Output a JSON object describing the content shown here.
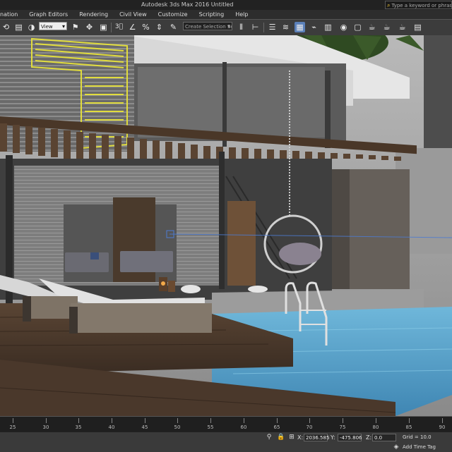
{
  "window": {
    "title": "Autodesk 3ds Max 2016    Untitled",
    "search_placeholder": "Type a keyword or phrase"
  },
  "menu": {
    "items": [
      "nation",
      "Graph Editors",
      "Rendering",
      "Civil View",
      "Customize",
      "Scripting",
      "Help"
    ]
  },
  "toolbar": {
    "view_dropdown": "View",
    "selection_set": "Create Selection Se",
    "icons": [
      "undo-icon",
      "select-link-icon",
      "bind-spacewarp-icon",
      "view-dropdown",
      "select-filter-icon",
      "move-icon",
      "scale-icon",
      "snap-3-icon",
      "angle-snap-icon",
      "percent-snap-icon",
      "spinner-snap-icon",
      "edit-named-selection-icon",
      "mirror-icon",
      "align-icon",
      "layer-manager-icon",
      "ribbon-icon",
      "curve-editor-icon",
      "schematic-view-icon",
      "material-editor-icon",
      "render-setup-icon",
      "rendered-frame-icon",
      "render-icon",
      "render-iterative-icon",
      "activeshade-icon"
    ]
  },
  "timeline": {
    "ticks": [
      "25",
      "30",
      "35",
      "40",
      "45",
      "50",
      "55",
      "60",
      "65",
      "70",
      "75",
      "80",
      "85",
      "90"
    ]
  },
  "status": {
    "x_label": "X:",
    "x_value": "2036.585",
    "y_label": "Y:",
    "y_value": "-475.806",
    "z_label": "Z:",
    "z_value": "0.0",
    "grid": "Grid = 10.0",
    "add_time_tag": "Add Time Tag"
  },
  "colors": {
    "accent": "#5a7fb8",
    "neon_sign": "#e7e23a",
    "pool_water": "#5fa8cf"
  }
}
